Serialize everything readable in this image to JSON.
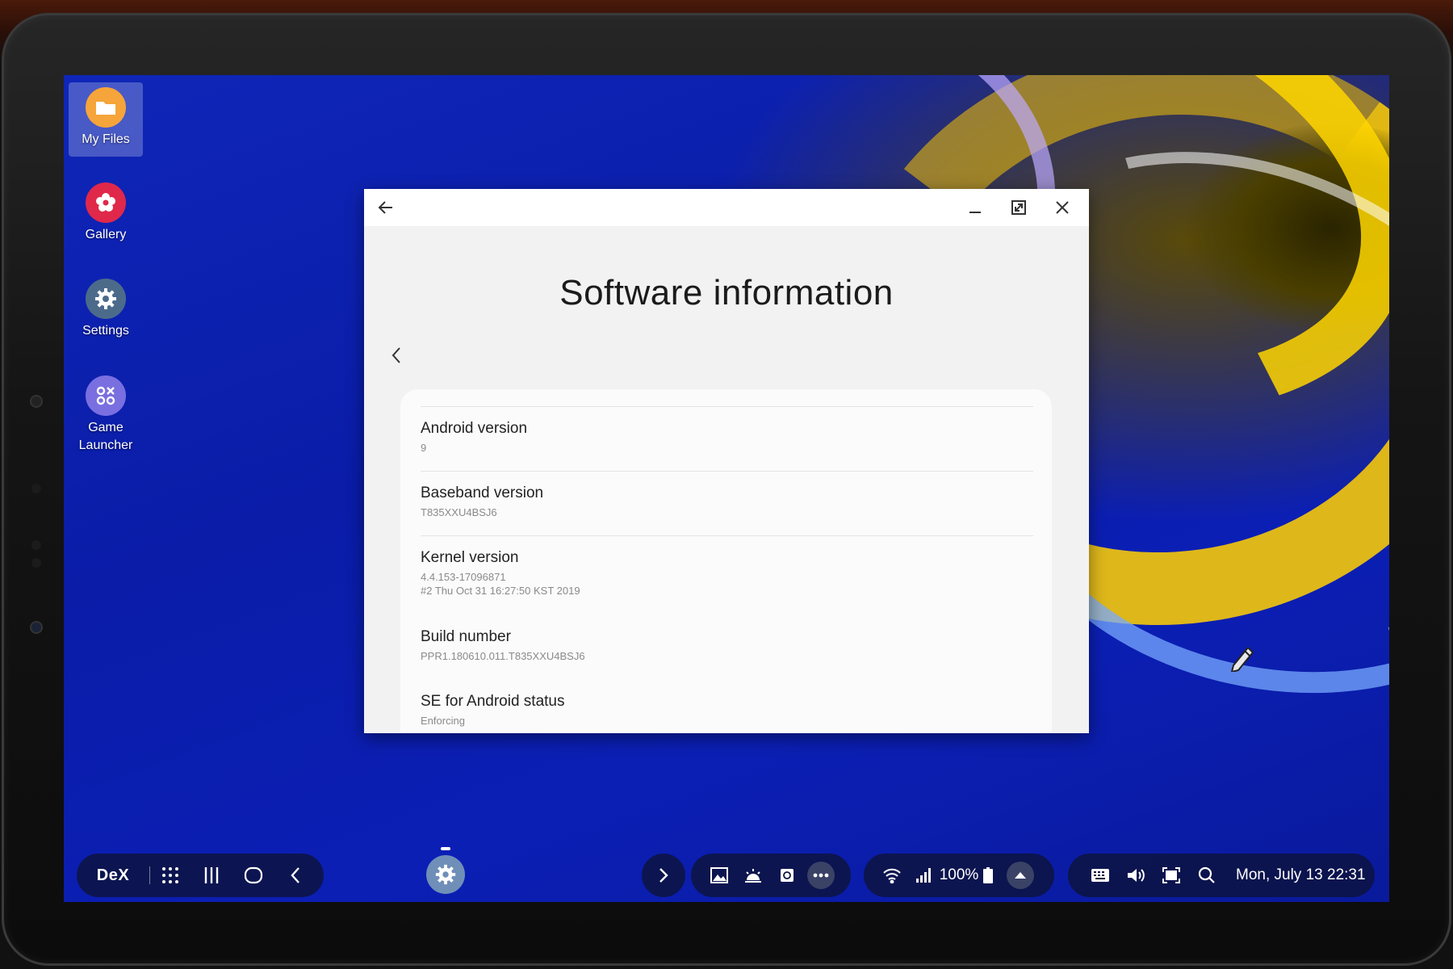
{
  "desktop": {
    "icons": [
      {
        "label": "My Files",
        "icon": "folder-icon",
        "color": "#f5a53a"
      },
      {
        "label": "Gallery",
        "icon": "flower-icon",
        "color": "#e0284a"
      },
      {
        "label": "Settings",
        "icon": "gear-icon",
        "color": "#4c6b8a"
      },
      {
        "label": "Game\nLauncher",
        "icon": "game-launcher-icon",
        "color": "#7a6fe0"
      }
    ]
  },
  "window": {
    "title": "Software information",
    "rows": [
      {
        "label": "Android version",
        "value": "9"
      },
      {
        "label": "Baseband version",
        "value": "T835XXU4BSJ6"
      },
      {
        "label": "Kernel version",
        "value": "4.4.153-17096871\n#2 Thu Oct 31 16:27:50 KST 2019"
      },
      {
        "label": "Build number",
        "value": "PPR1.180610.011.T835XXU4BSJ6"
      },
      {
        "label": "SE for Android status",
        "value": "Enforcing"
      }
    ]
  },
  "taskbar": {
    "dex_label": "DeX",
    "battery": "100%",
    "clock": "Mon, July 13 22:31"
  },
  "colors": {
    "accent_blue": "#0b1fb5",
    "accent_yellow": "#f5c80a",
    "taskbar_bg": "#0c143c"
  }
}
